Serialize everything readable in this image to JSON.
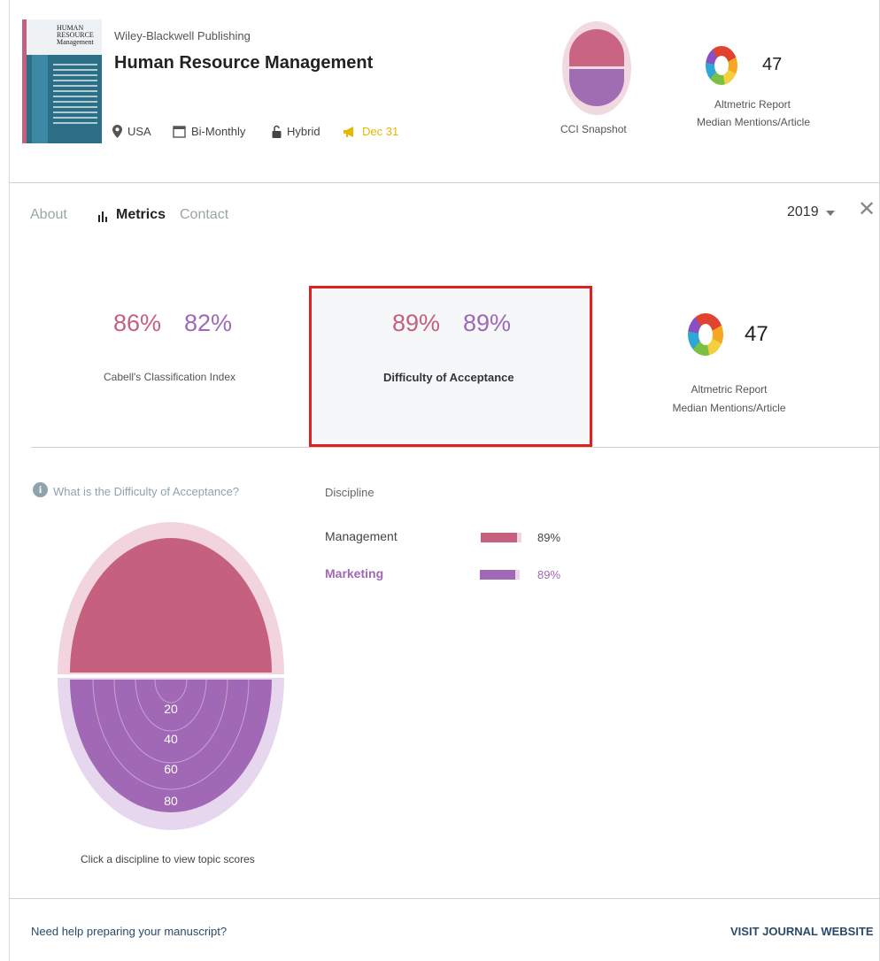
{
  "journal": {
    "cover_text": "HUMAN RESOURCE Management",
    "publisher": "Wiley-Blackwell Publishing",
    "title": "Human Resource Management",
    "country": "USA",
    "frequency": "Bi-Monthly",
    "access": "Hybrid",
    "deadline": "Dec 31"
  },
  "header": {
    "cci_label": "CCI Snapshot",
    "altmetric_value": "47",
    "altmetric_line1": "Altmetric Report",
    "altmetric_line2": "Median Mentions/Article"
  },
  "tabs": [
    {
      "label": "About"
    },
    {
      "label": "Metrics"
    },
    {
      "label": "Contact"
    }
  ],
  "year": "2019",
  "metrics": {
    "cci": {
      "value1": "86%",
      "value2": "82%",
      "label": "Cabell's Classification Index"
    },
    "doa": {
      "value1": "89%",
      "value2": "89%",
      "label": "Difficulty of Acceptance"
    },
    "altmetric": {
      "value": "47",
      "line1": "Altmetric Report",
      "line2": "Median Mentions/Article"
    }
  },
  "details": {
    "info_link": "What is the Difficulty of Acceptance?",
    "discipline_header": "Discipline",
    "disciplines": [
      {
        "name": "Management",
        "value": "89%",
        "level": 0.89,
        "color": "#c5607e"
      },
      {
        "name": "Marketing",
        "value": "89%",
        "level": 0.89,
        "color": "#a068b5"
      }
    ],
    "rings": [
      "20",
      "40",
      "60",
      "80"
    ],
    "hint": "Click a discipline to view topic scores"
  },
  "footer": {
    "help": "Need help preparing your manuscript?",
    "visit": "VISIT JOURNAL WEBSITE"
  },
  "colors": {
    "pink": "#c5607e",
    "purple": "#a068b5",
    "highlight": "#e02020"
  }
}
